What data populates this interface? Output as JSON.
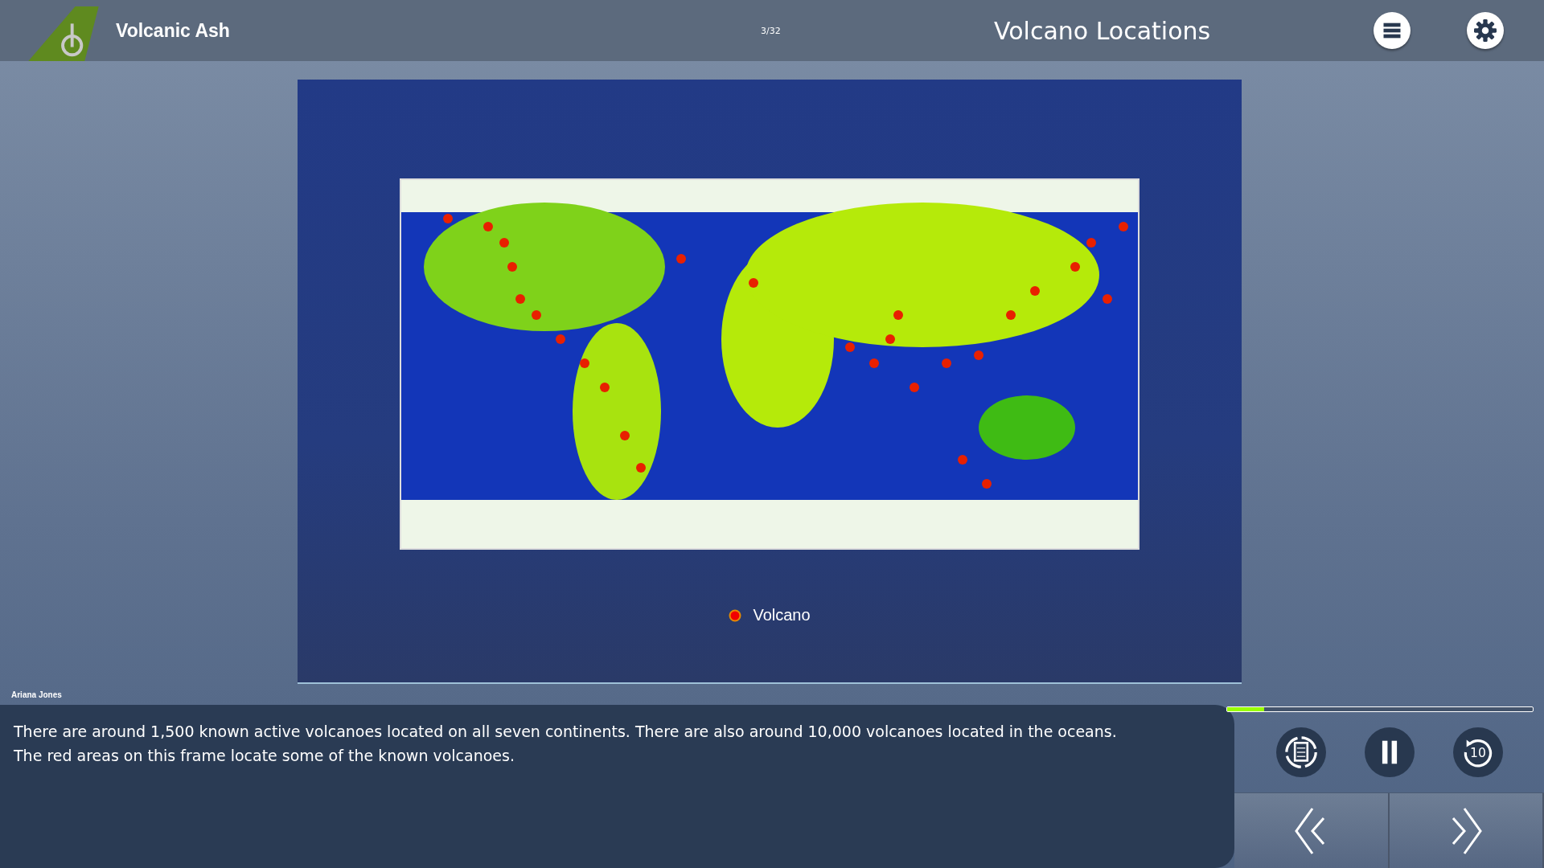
{
  "header": {
    "course_title": "Volcanic Ash",
    "page_counter": "3/32",
    "slide_title": "Volcano Locations"
  },
  "slide": {
    "legend": [
      {
        "label": "Volcano"
      }
    ]
  },
  "narrator": "Ariana Jones",
  "caption": [
    "There are around 1,500 known active volcanoes located on all seven continents. There are also around 10,000 volcanoes located in the oceans.",
    "The red areas on this frame locate some of the known volcanoes."
  ],
  "progress": {
    "level": 0.12
  },
  "rewind_label": "10"
}
